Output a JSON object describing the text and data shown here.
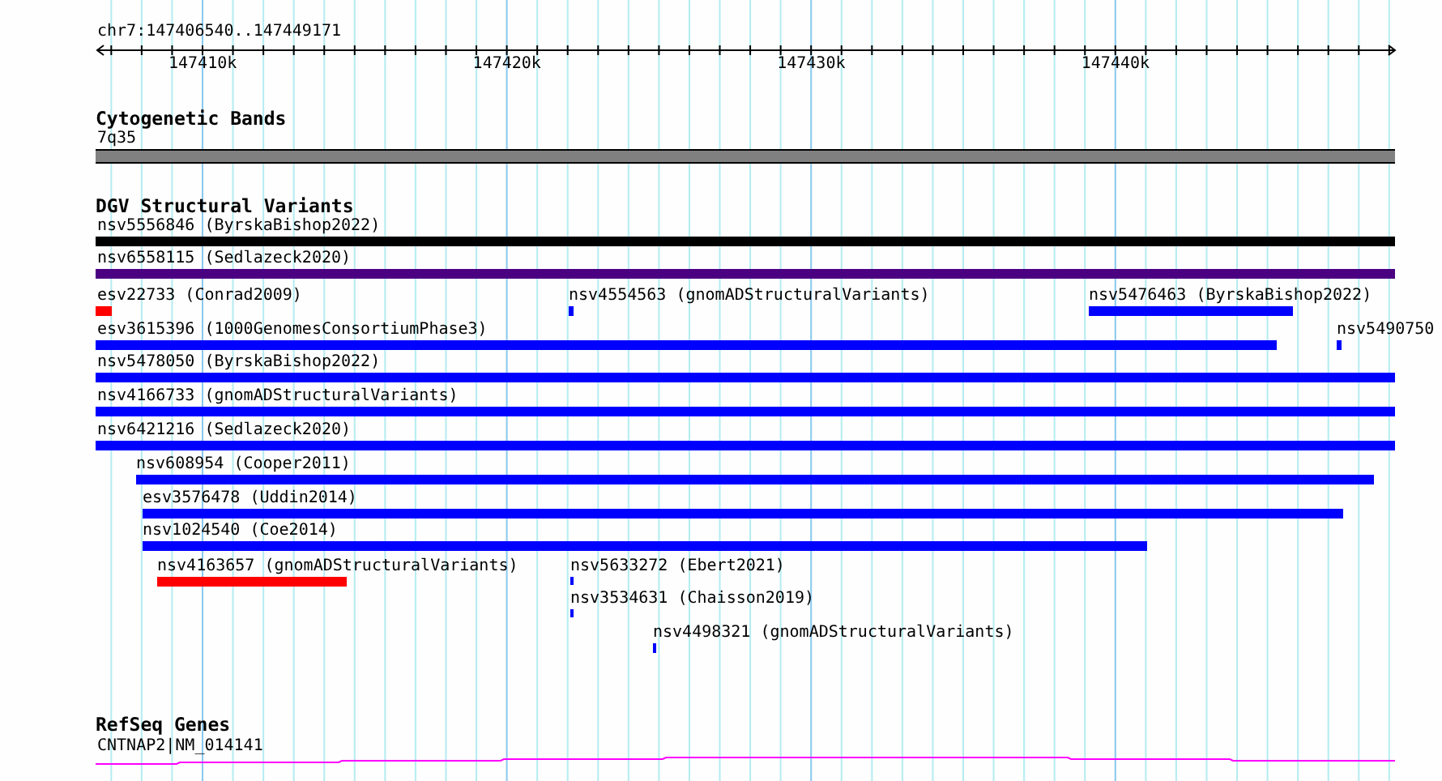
{
  "location": "chr7:147406540..147449171",
  "ruler": {
    "ticks": [
      "147410k",
      "147420k",
      "147430k",
      "147440k"
    ]
  },
  "tracks": [
    {
      "kind": "bands",
      "title": "Cytogenetic Bands",
      "features": [
        {
          "label": "7q35"
        }
      ]
    },
    {
      "kind": "variants",
      "title": "DGV Structural Variants",
      "features": [
        {
          "label": "nsv5556846 (ByrskaBishop2022)",
          "color": "#000000"
        },
        {
          "label": "nsv6558115 (Sedlazeck2020)",
          "color": "#4b0082"
        },
        {
          "label": "esv22733 (Conrad2009)",
          "color": "#ff0000"
        },
        {
          "label": "nsv4554563 (gnomADStructuralVariants)",
          "color": "#0000ff"
        },
        {
          "label": "nsv5476463 (ByrskaBishop2022)",
          "color": "#0000ff"
        },
        {
          "label": "esv3615396 (1000GenomesConsortiumPhase3)",
          "color": "#0000ff"
        },
        {
          "label": "nsv5490750",
          "color": "#0000ff"
        },
        {
          "label": "nsv5478050 (ByrskaBishop2022)",
          "color": "#0000ff"
        },
        {
          "label": "nsv4166733 (gnomADStructuralVariants)",
          "color": "#0000ff"
        },
        {
          "label": "nsv6421216 (Sedlazeck2020)",
          "color": "#0000ff"
        },
        {
          "label": "nsv608954 (Cooper2011)",
          "color": "#0000ff"
        },
        {
          "label": "esv3576478 (Uddin2014)",
          "color": "#0000ff"
        },
        {
          "label": "nsv1024540 (Coe2014)",
          "color": "#0000ff"
        },
        {
          "label": "nsv4163657 (gnomADStructuralVariants)",
          "color": "#ff0000"
        },
        {
          "label": "nsv5633272 (Ebert2021)",
          "color": "#0000ff"
        },
        {
          "label": "nsv3534631 (Chaisson2019)",
          "color": "#0000ff"
        },
        {
          "label": "nsv4498321 (gnomADStructuralVariants)",
          "color": "#0000ff"
        }
      ]
    },
    {
      "kind": "genes",
      "title": "RefSeq Genes",
      "features": [
        {
          "label": "CNTNAP2|NM_014141"
        }
      ]
    }
  ]
}
